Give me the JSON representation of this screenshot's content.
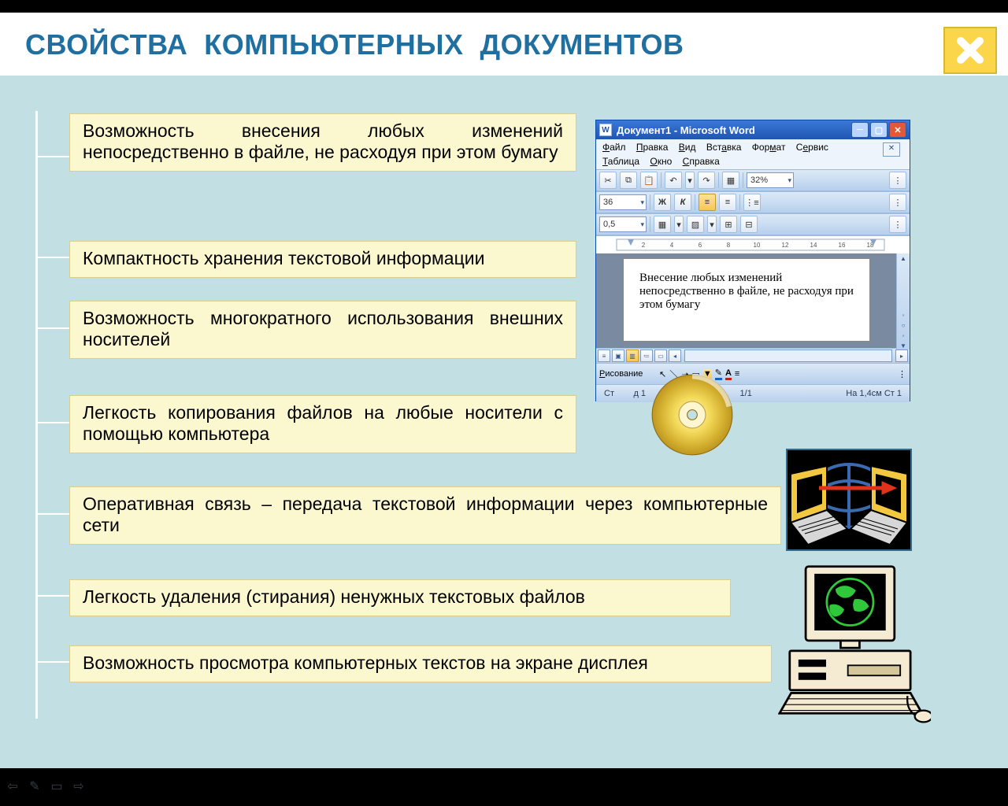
{
  "title": "СВОЙСТВА  КОМПЬЮТЕРНЫХ  ДОКУМЕНТОВ",
  "close_label": "✕",
  "items": [
    "Возможность внесения любых изменений непосредственно в файле, не расходуя при этом  бумагу",
    "Компактность хранения текстовой информации",
    "Возможность многократного использования внешних носителей",
    "Легкость копирования файлов на любые носители                 с помощью компьютера",
    "Оперативная связь – передача текстовой информации через компьютерные сети",
    "Легкость удаления (стирания) ненужных текстовых файлов",
    "Возможность просмотра компьютерных текстов на экране дисплея"
  ],
  "word": {
    "titlebar": "Документ1 - Microsoft Word",
    "menu": [
      "Файл",
      "Правка",
      "Вид",
      "Вставка",
      "Формат",
      "Сервис",
      "Таблица",
      "Окно",
      "Справка"
    ],
    "zoom": "32%",
    "fontsize": "36",
    "style_bold": "Ж",
    "style_italic": "К",
    "linespacing": "0,5",
    "ruler_numbers": [
      "2",
      "4",
      "6",
      "8",
      "10",
      "12",
      "14",
      "16",
      "18"
    ],
    "doc_text": "Внесение любых изменений непосредственно в файле, не расходуя при этом бумагу",
    "drawbar_label": "Рисование",
    "font_letter": "A",
    "status_left": "Ст",
    "status_sec": "д 1",
    "status_page": "1/1",
    "status_pos": "На 1,4см   Ст 1"
  },
  "viewer": {
    "prev": "⇦",
    "pen": "✎",
    "menu": "▭",
    "next": "⇨"
  }
}
